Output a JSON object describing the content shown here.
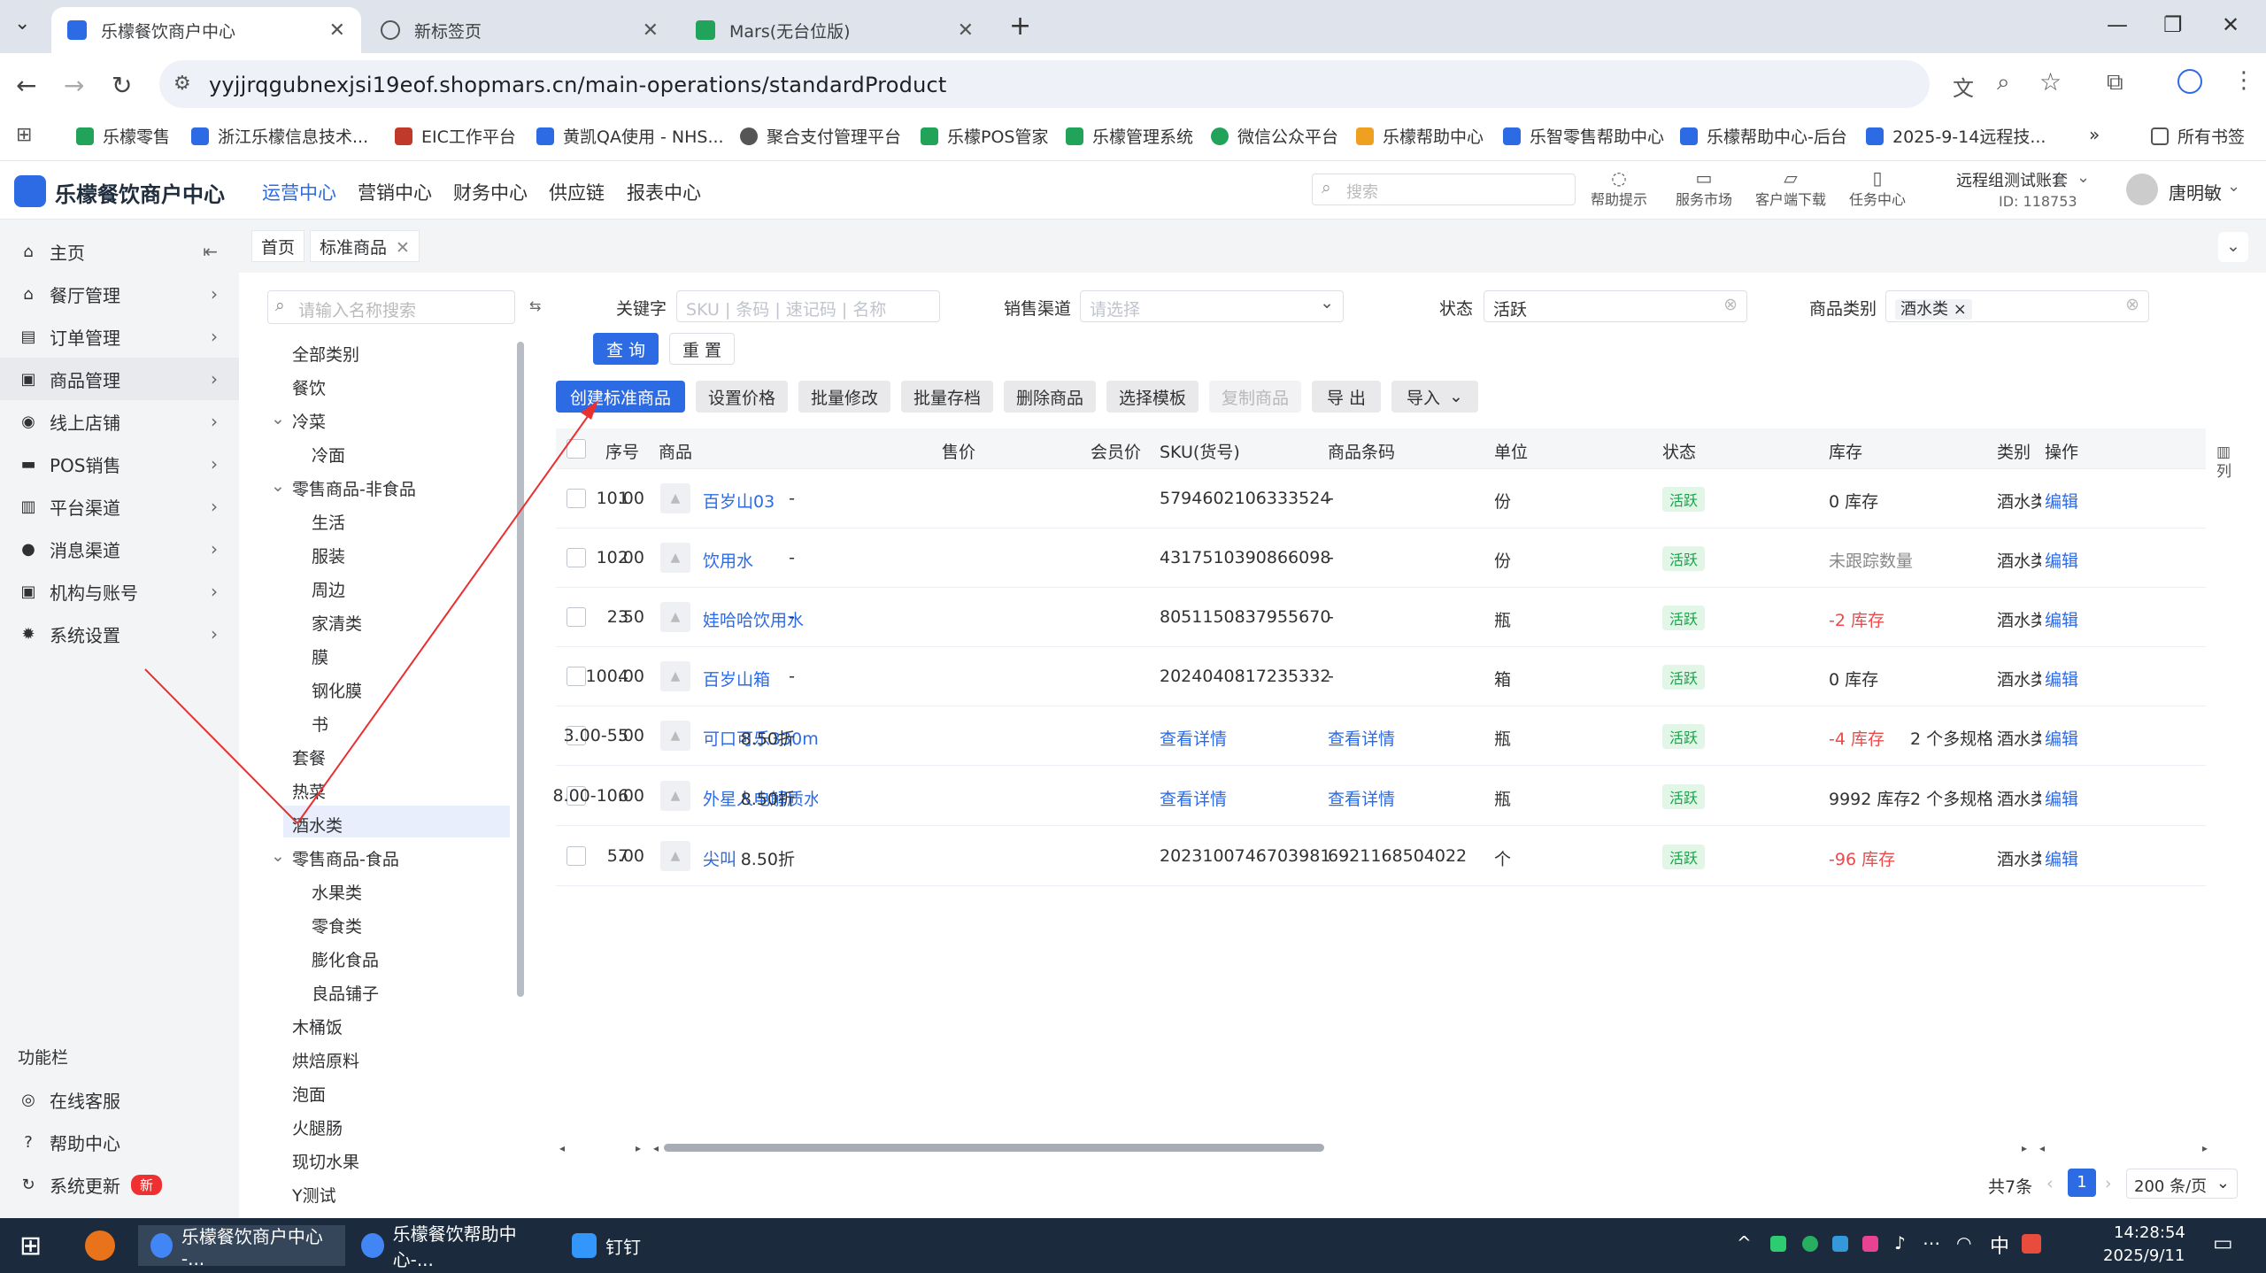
{
  "browser": {
    "tabs": [
      {
        "title": "乐檬餐饮商户中心",
        "active": true
      },
      {
        "title": "新标签页",
        "active": false
      },
      {
        "title": "Mars(无台位版)",
        "active": false
      }
    ],
    "url": "yyjjrqgubnexjsi19eof.shopmars.cn/main-operations/standardProduct",
    "bookmarks": [
      "乐檬零售",
      "浙江乐檬信息技术...",
      "EIC工作平台",
      "黄凯QA使用 - NHS...",
      "聚合支付管理平台",
      "乐檬POS管家",
      "乐檬管理系统",
      "微信公众平台",
      "乐檬帮助中心",
      "乐智零售帮助中心",
      "乐檬帮助中心-后台",
      "2025-9-14远程技..."
    ],
    "all_bookmarks": "所有书签"
  },
  "app": {
    "logo": "乐檬餐饮商户中心",
    "nav": [
      "运营中心",
      "营销中心",
      "财务中心",
      "供应链",
      "报表中心"
    ],
    "search_placeholder": "搜索",
    "header_icons": [
      "帮助提示",
      "服务市场",
      "客户端下载",
      "任务中心"
    ],
    "account": {
      "name": "远程组测试账套",
      "id": "ID: 118753"
    },
    "user": "唐明敏"
  },
  "sidebar": {
    "items": [
      "主页",
      "餐厅管理",
      "订单管理",
      "商品管理",
      "线上店铺",
      "POS销售",
      "平台渠道",
      "消息渠道",
      "机构与账号",
      "系统设置"
    ],
    "func_title": "功能栏",
    "func": [
      "在线客服",
      "帮助中心",
      "系统更新"
    ],
    "new_badge": "新"
  },
  "page_tabs": [
    "首页",
    "标准商品"
  ],
  "tree": {
    "search_placeholder": "请输入名称搜索",
    "nodes": [
      "全部类别",
      "餐饮",
      "冷菜",
      "冷面",
      "零售商品-非食品",
      "生活",
      "服装",
      "周边",
      "家清类",
      "膜",
      "钢化膜",
      "书",
      "套餐",
      "热菜",
      "酒水类",
      "零售商品-食品",
      "水果类",
      "零食类",
      "膨化食品",
      "良品铺子",
      "木桶饭",
      "烘焙原料",
      "泡面",
      "火腿肠",
      "现切水果",
      "Y测试"
    ]
  },
  "filters": {
    "keyword_label": "关键字",
    "keyword_placeholder": "SKU | 条码 | 速记码 | 名称",
    "channel_label": "销售渠道",
    "channel_placeholder": "请选择",
    "status_label": "状态",
    "status_value": "活跃",
    "category_label": "商品类别",
    "category_tag": "酒水类",
    "query": "查 询",
    "reset": "重 置"
  },
  "actions": [
    "创建标准商品",
    "设置价格",
    "批量修改",
    "批量存档",
    "删除商品",
    "选择模板",
    "复制商品",
    "导 出",
    "导入"
  ],
  "table": {
    "headers": [
      "序号",
      "商品",
      "售价",
      "会员价",
      "SKU(货号)",
      "商品条码",
      "单位",
      "状态",
      "库存",
      "类别",
      "操作"
    ],
    "col_setting": "列",
    "rows": [
      {
        "no": "1",
        "name": "百岁山03",
        "price": "10.00",
        "member": "-",
        "sku": "5794602106333524",
        "barcode": "-",
        "unit": "份",
        "status": "活跃",
        "stock": "0 库存",
        "spec": "",
        "cat": "酒水类",
        "op": "编辑"
      },
      {
        "no": "2",
        "name": "饮用水",
        "price": "10.00",
        "member": "-",
        "sku": "4317510390866098",
        "barcode": "-",
        "unit": "份",
        "status": "活跃",
        "stock": "未跟踪数量",
        "spec": "",
        "cat": "酒水类",
        "op": "编辑"
      },
      {
        "no": "3",
        "name": "娃哈哈饮用水",
        "price": "2.50",
        "member": "-",
        "sku": "8051150837955670",
        "barcode": "-",
        "unit": "瓶",
        "status": "活跃",
        "stock": "-2 库存",
        "spec": "",
        "cat": "酒水类",
        "op": "编辑"
      },
      {
        "no": "4",
        "name": "百岁山箱",
        "price": "100.00",
        "member": "-",
        "sku": "2024040817235332",
        "barcode": "-",
        "unit": "箱",
        "status": "活跃",
        "stock": "0 库存",
        "spec": "",
        "cat": "酒水类",
        "op": "编辑"
      },
      {
        "no": "5",
        "name": "可口可乐330m",
        "price": "3.00-5.00",
        "member": "8.50折",
        "sku": "查看详情",
        "barcode": "查看详情",
        "unit": "瓶",
        "status": "活跃",
        "stock": "-4 库存",
        "spec": "2 个多规格",
        "cat": "酒水类",
        "op": "编辑"
      },
      {
        "no": "6",
        "name": "外星人电解质水",
        "price": "8.00-10.00",
        "member": "8.50折",
        "sku": "查看详情",
        "barcode": "查看详情",
        "unit": "瓶",
        "status": "活跃",
        "stock": "9992 库存",
        "spec": "2 个多规格",
        "cat": "酒水类",
        "op": "编辑"
      },
      {
        "no": "7",
        "name": "尖叫",
        "price": "5.00",
        "member": "8.50折",
        "sku": "2023100746703981",
        "barcode": "6921168504022",
        "unit": "个",
        "status": "活跃",
        "stock": "-96 库存",
        "spec": "",
        "cat": "酒水类",
        "op": "编辑"
      }
    ]
  },
  "pagination": {
    "total": "共7条",
    "page": "1",
    "size": "200 条/页"
  },
  "taskbar": {
    "apps": [
      "乐檬餐饮商户中心 -...",
      "乐檬餐饮帮助中心-...",
      "钉钉"
    ],
    "time": "14:28:54",
    "date": "2025/9/11",
    "ime": "中"
  }
}
